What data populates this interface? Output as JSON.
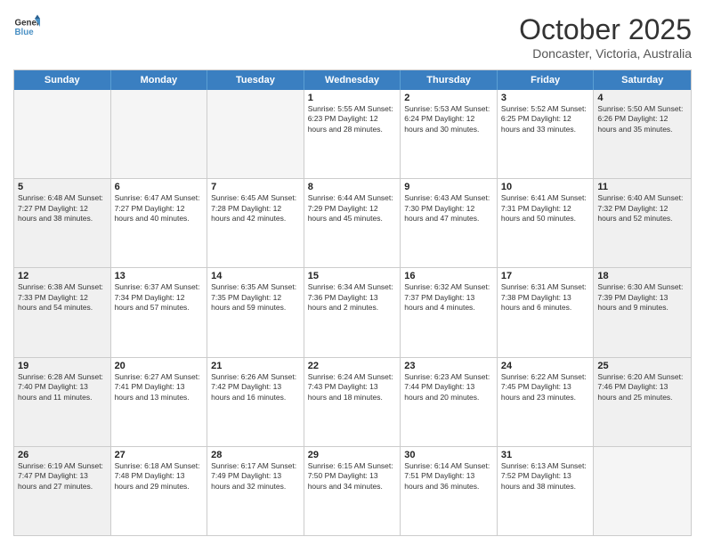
{
  "header": {
    "logo_general": "General",
    "logo_blue": "Blue",
    "month_title": "October 2025",
    "location": "Doncaster, Victoria, Australia"
  },
  "calendar": {
    "days_of_week": [
      "Sunday",
      "Monday",
      "Tuesday",
      "Wednesday",
      "Thursday",
      "Friday",
      "Saturday"
    ],
    "weeks": [
      [
        {
          "day": "",
          "info": "",
          "empty": true
        },
        {
          "day": "",
          "info": "",
          "empty": true
        },
        {
          "day": "",
          "info": "",
          "empty": true
        },
        {
          "day": "1",
          "info": "Sunrise: 5:55 AM\nSunset: 6:23 PM\nDaylight: 12 hours\nand 28 minutes.",
          "empty": false
        },
        {
          "day": "2",
          "info": "Sunrise: 5:53 AM\nSunset: 6:24 PM\nDaylight: 12 hours\nand 30 minutes.",
          "empty": false
        },
        {
          "day": "3",
          "info": "Sunrise: 5:52 AM\nSunset: 6:25 PM\nDaylight: 12 hours\nand 33 minutes.",
          "empty": false
        },
        {
          "day": "4",
          "info": "Sunrise: 5:50 AM\nSunset: 6:26 PM\nDaylight: 12 hours\nand 35 minutes.",
          "empty": false
        }
      ],
      [
        {
          "day": "5",
          "info": "Sunrise: 6:48 AM\nSunset: 7:27 PM\nDaylight: 12 hours\nand 38 minutes.",
          "empty": false
        },
        {
          "day": "6",
          "info": "Sunrise: 6:47 AM\nSunset: 7:27 PM\nDaylight: 12 hours\nand 40 minutes.",
          "empty": false
        },
        {
          "day": "7",
          "info": "Sunrise: 6:45 AM\nSunset: 7:28 PM\nDaylight: 12 hours\nand 42 minutes.",
          "empty": false
        },
        {
          "day": "8",
          "info": "Sunrise: 6:44 AM\nSunset: 7:29 PM\nDaylight: 12 hours\nand 45 minutes.",
          "empty": false
        },
        {
          "day": "9",
          "info": "Sunrise: 6:43 AM\nSunset: 7:30 PM\nDaylight: 12 hours\nand 47 minutes.",
          "empty": false
        },
        {
          "day": "10",
          "info": "Sunrise: 6:41 AM\nSunset: 7:31 PM\nDaylight: 12 hours\nand 50 minutes.",
          "empty": false
        },
        {
          "day": "11",
          "info": "Sunrise: 6:40 AM\nSunset: 7:32 PM\nDaylight: 12 hours\nand 52 minutes.",
          "empty": false
        }
      ],
      [
        {
          "day": "12",
          "info": "Sunrise: 6:38 AM\nSunset: 7:33 PM\nDaylight: 12 hours\nand 54 minutes.",
          "empty": false
        },
        {
          "day": "13",
          "info": "Sunrise: 6:37 AM\nSunset: 7:34 PM\nDaylight: 12 hours\nand 57 minutes.",
          "empty": false
        },
        {
          "day": "14",
          "info": "Sunrise: 6:35 AM\nSunset: 7:35 PM\nDaylight: 12 hours\nand 59 minutes.",
          "empty": false
        },
        {
          "day": "15",
          "info": "Sunrise: 6:34 AM\nSunset: 7:36 PM\nDaylight: 13 hours\nand 2 minutes.",
          "empty": false
        },
        {
          "day": "16",
          "info": "Sunrise: 6:32 AM\nSunset: 7:37 PM\nDaylight: 13 hours\nand 4 minutes.",
          "empty": false
        },
        {
          "day": "17",
          "info": "Sunrise: 6:31 AM\nSunset: 7:38 PM\nDaylight: 13 hours\nand 6 minutes.",
          "empty": false
        },
        {
          "day": "18",
          "info": "Sunrise: 6:30 AM\nSunset: 7:39 PM\nDaylight: 13 hours\nand 9 minutes.",
          "empty": false
        }
      ],
      [
        {
          "day": "19",
          "info": "Sunrise: 6:28 AM\nSunset: 7:40 PM\nDaylight: 13 hours\nand 11 minutes.",
          "empty": false
        },
        {
          "day": "20",
          "info": "Sunrise: 6:27 AM\nSunset: 7:41 PM\nDaylight: 13 hours\nand 13 minutes.",
          "empty": false
        },
        {
          "day": "21",
          "info": "Sunrise: 6:26 AM\nSunset: 7:42 PM\nDaylight: 13 hours\nand 16 minutes.",
          "empty": false
        },
        {
          "day": "22",
          "info": "Sunrise: 6:24 AM\nSunset: 7:43 PM\nDaylight: 13 hours\nand 18 minutes.",
          "empty": false
        },
        {
          "day": "23",
          "info": "Sunrise: 6:23 AM\nSunset: 7:44 PM\nDaylight: 13 hours\nand 20 minutes.",
          "empty": false
        },
        {
          "day": "24",
          "info": "Sunrise: 6:22 AM\nSunset: 7:45 PM\nDaylight: 13 hours\nand 23 minutes.",
          "empty": false
        },
        {
          "day": "25",
          "info": "Sunrise: 6:20 AM\nSunset: 7:46 PM\nDaylight: 13 hours\nand 25 minutes.",
          "empty": false
        }
      ],
      [
        {
          "day": "26",
          "info": "Sunrise: 6:19 AM\nSunset: 7:47 PM\nDaylight: 13 hours\nand 27 minutes.",
          "empty": false
        },
        {
          "day": "27",
          "info": "Sunrise: 6:18 AM\nSunset: 7:48 PM\nDaylight: 13 hours\nand 29 minutes.",
          "empty": false
        },
        {
          "day": "28",
          "info": "Sunrise: 6:17 AM\nSunset: 7:49 PM\nDaylight: 13 hours\nand 32 minutes.",
          "empty": false
        },
        {
          "day": "29",
          "info": "Sunrise: 6:15 AM\nSunset: 7:50 PM\nDaylight: 13 hours\nand 34 minutes.",
          "empty": false
        },
        {
          "day": "30",
          "info": "Sunrise: 6:14 AM\nSunset: 7:51 PM\nDaylight: 13 hours\nand 36 minutes.",
          "empty": false
        },
        {
          "day": "31",
          "info": "Sunrise: 6:13 AM\nSunset: 7:52 PM\nDaylight: 13 hours\nand 38 minutes.",
          "empty": false
        },
        {
          "day": "",
          "info": "",
          "empty": true
        }
      ]
    ]
  }
}
